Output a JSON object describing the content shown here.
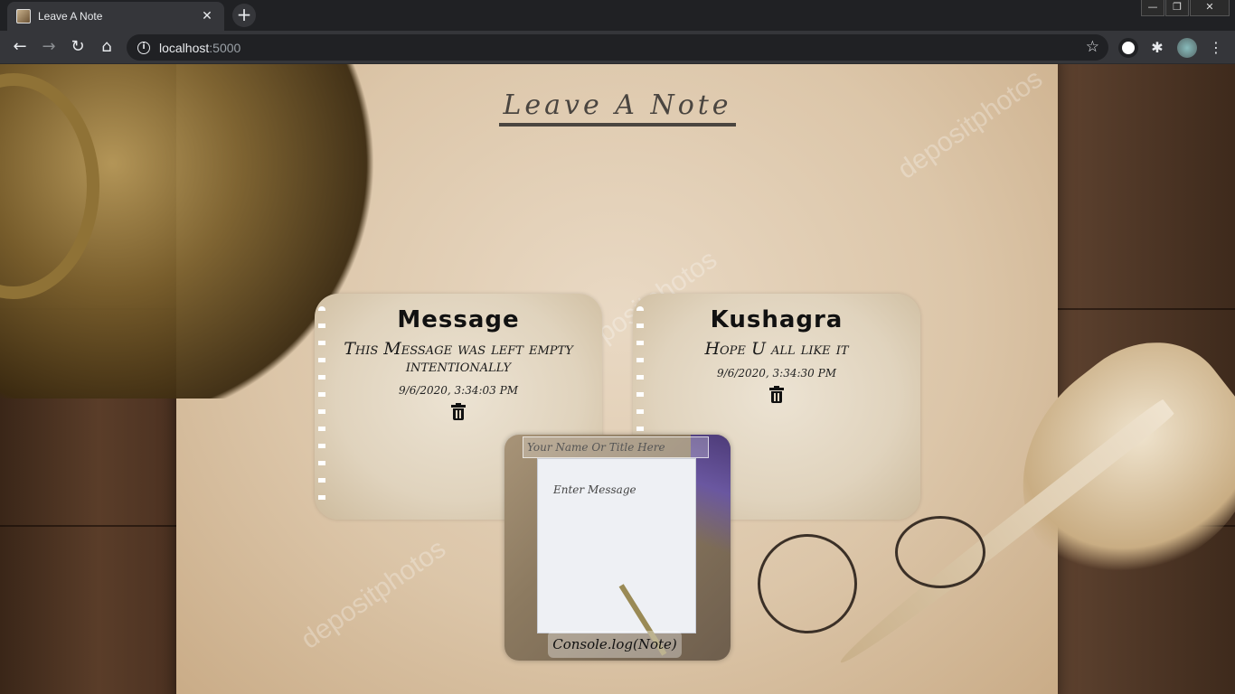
{
  "browser": {
    "tab_title": "Leave A Note",
    "new_tab_symbol": "+",
    "url_host": "localhost",
    "url_port": ":5000"
  },
  "page": {
    "heading": "Leave A Note",
    "watermark": "depositphotos",
    "notes": [
      {
        "title": "Message",
        "message": "This Message was left empty intentionally",
        "timestamp": "9/6/2020, 3:34:03 PM"
      },
      {
        "title": "Kushagra",
        "message": "Hope U all like it",
        "timestamp": "9/6/2020, 3:34:30 PM"
      }
    ],
    "form": {
      "title_placeholder": "Your Name Or Title Here",
      "message_placeholder": "Enter Message",
      "submit_label": "Console.log(Note)"
    }
  },
  "icons": {
    "close": "close-icon",
    "back": "back-arrow-icon",
    "forward": "forward-arrow-icon",
    "reload": "reload-icon",
    "home": "home-icon",
    "info": "info-icon",
    "star": "star-icon",
    "extensions": "puzzle-icon",
    "trash": "trash-icon"
  }
}
